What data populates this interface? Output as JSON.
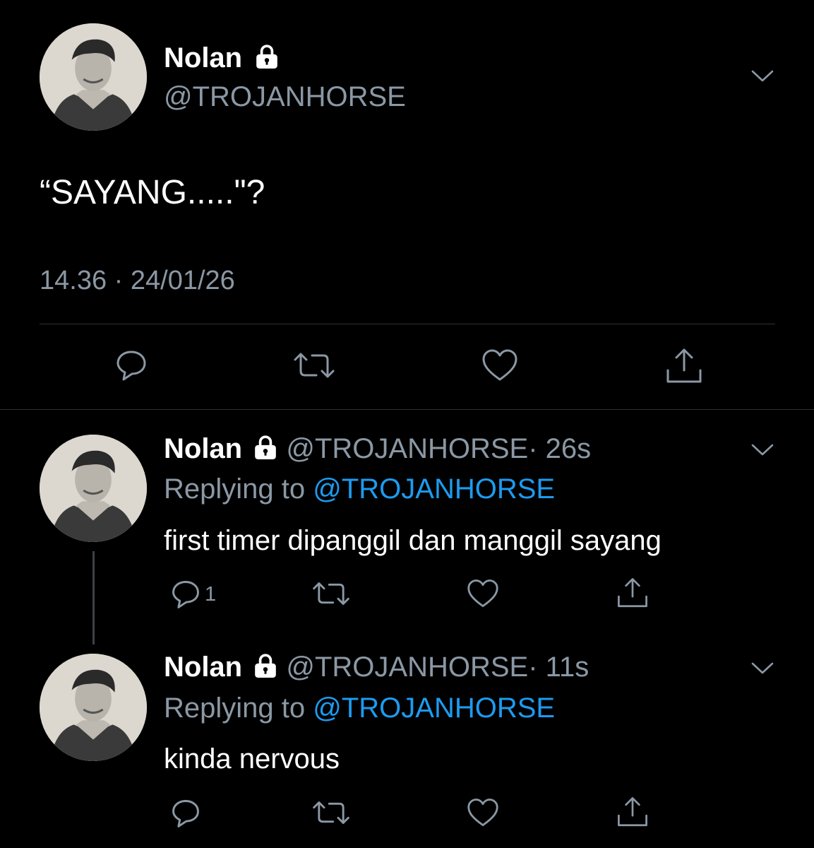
{
  "main_tweet": {
    "name": "Nolan",
    "handle": "@TROJANHORSE",
    "text": "“SAYANG.....\"?",
    "timestamp": "14.36 · 24/01/26"
  },
  "replies": [
    {
      "name": "Nolan",
      "handle": "@TROJANHORSE",
      "time": "· 26s",
      "replying_prefix": "Replying to",
      "replying_handle": "@TROJANHORSE",
      "text": "first timer dipanggil dan manggil sayang",
      "reply_count": "1"
    },
    {
      "name": "Nolan",
      "handle": "@TROJANHORSE",
      "time": "· 11s",
      "replying_prefix": "Replying to",
      "replying_handle": "@TROJANHORSE",
      "text": "kinda nervous",
      "reply_count": ""
    }
  ],
  "icons": {
    "reply": "reply-icon",
    "retweet": "retweet-icon",
    "like": "heart-icon",
    "share": "share-icon",
    "more": "chevron-down-icon",
    "protected": "lock-icon"
  },
  "colors": {
    "background": "#000000",
    "text": "#ffffff",
    "secondary": "#8b98a5",
    "link": "#1d9bf0"
  }
}
